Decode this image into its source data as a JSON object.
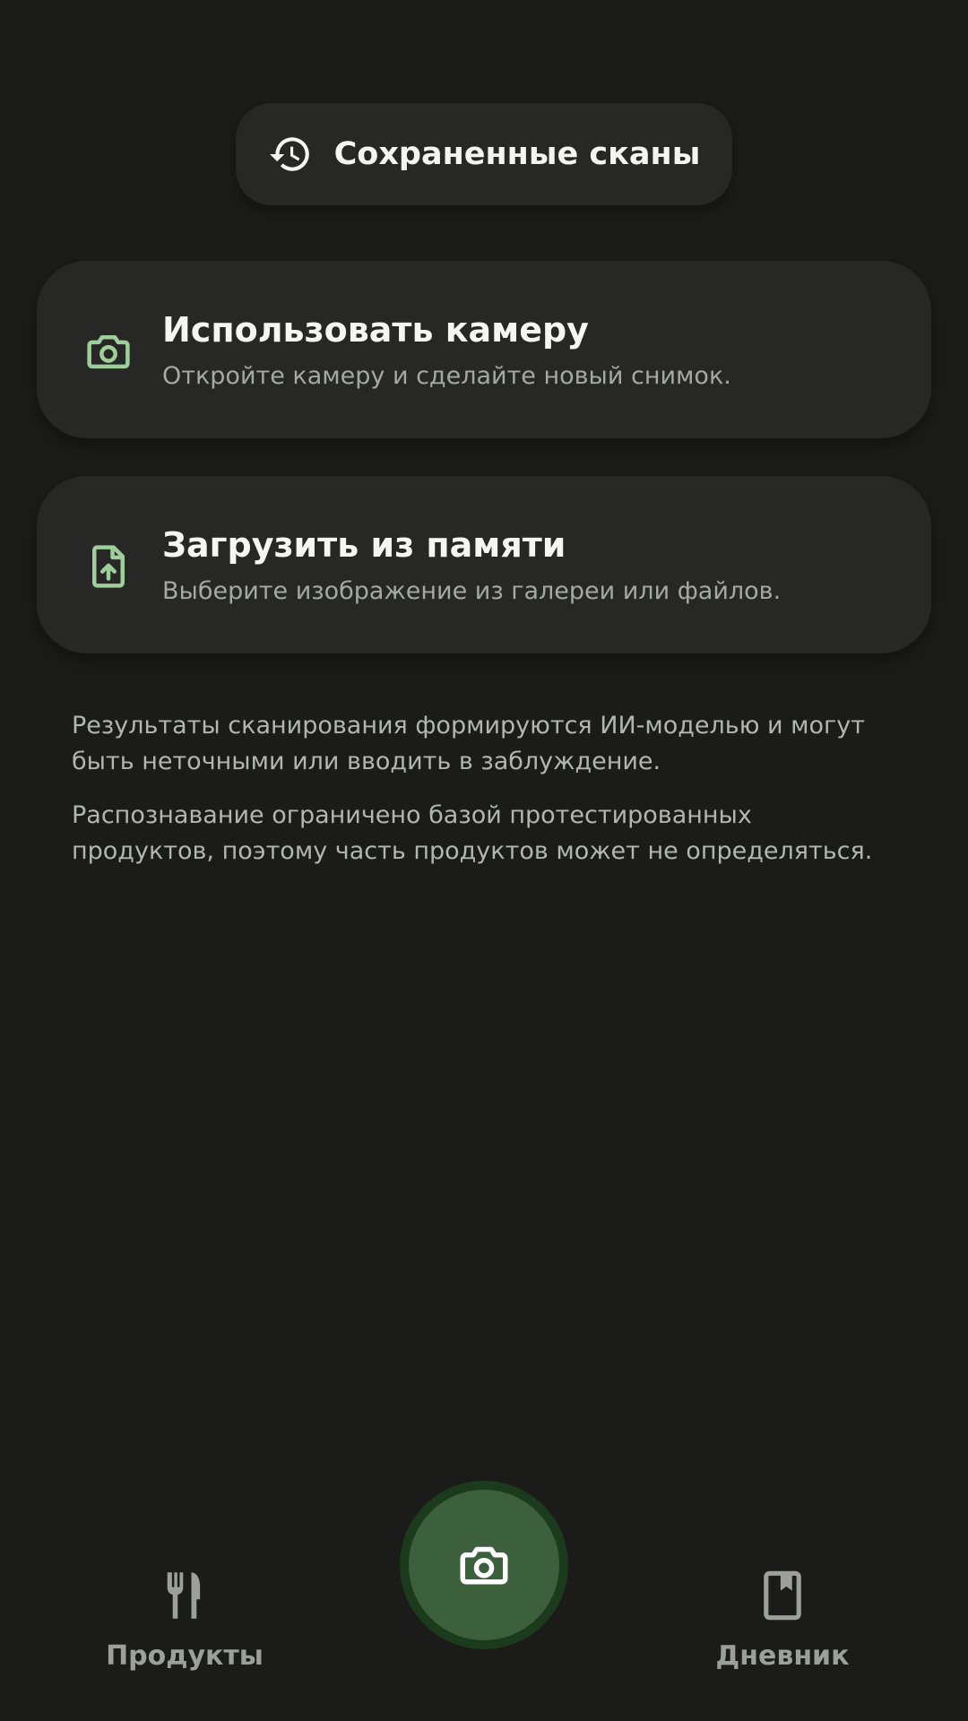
{
  "history": {
    "label": "Сохраненные сканы",
    "icon": "history-icon"
  },
  "options": {
    "camera": {
      "title": "Использовать камеру",
      "subtitle": "Откройте камеру и сделайте новый снимок.",
      "icon": "camera-icon"
    },
    "upload": {
      "title": "Загрузить из памяти",
      "subtitle": "Выберите изображение из галереи или файлов.",
      "icon": "file-upload-icon"
    }
  },
  "disclaimer": {
    "line1": "Результаты сканирования формируются ИИ-моделью и могут быть неточными или вводить в заблуждение.",
    "line2": "Распознавание ограничено базой протестированных продуктов, поэтому часть продуктов может не определяться."
  },
  "nav": {
    "products": {
      "label": "Продукты",
      "icon": "fork-knife-icon"
    },
    "scan": {
      "icon": "camera-icon"
    },
    "diary": {
      "label": "Дневник",
      "icon": "book-icon"
    }
  },
  "colors": {
    "background": "#1b1c1a",
    "card": "#272826",
    "accent_green": "#9ecf9b",
    "fab": "#3c5f3c",
    "fab_border": "#1c3a1c"
  }
}
